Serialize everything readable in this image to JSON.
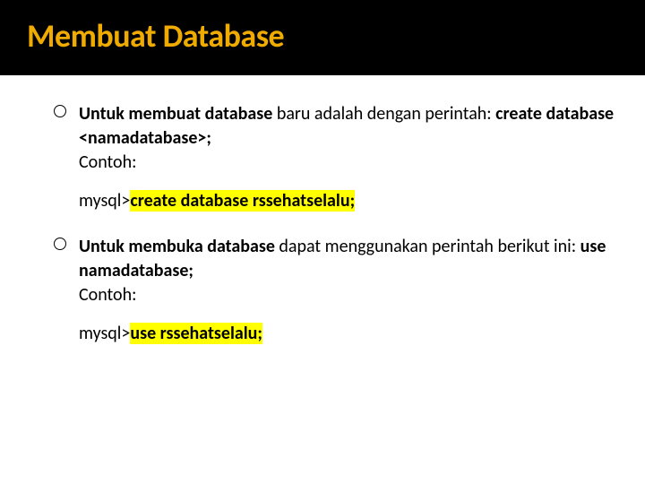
{
  "title": "Membuat Database",
  "item1": {
    "bold1": "Untuk membuat database",
    "rest1": " baru adalah dengan perintah: ",
    "bold2": "create database <namadatabase>;",
    "rest2": "Contoh:"
  },
  "code1": {
    "prefix": "mysql>",
    "hl": "create database rssehatselalu;"
  },
  "item2": {
    "bold1": "Untuk membuka database",
    "rest1": " dapat menggunakan perintah berikut ini: ",
    "bold2": "use namadatabase;",
    "rest2": "Contoh:"
  },
  "code2": {
    "prefix": "mysql>",
    "hl": "use rssehatselalu;"
  }
}
